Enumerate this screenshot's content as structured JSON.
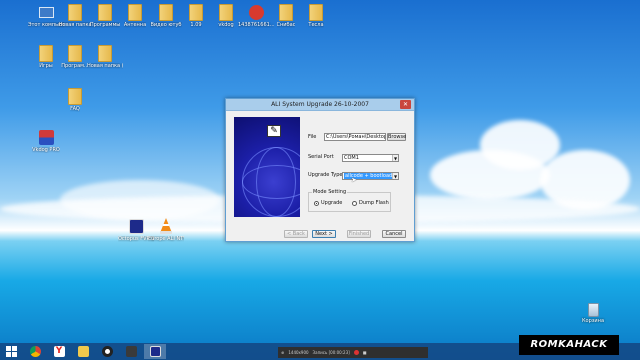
{
  "desktop": {
    "icons": [
      {
        "label": "Этот компьютер",
        "icon": "computer-icon"
      },
      {
        "label": "Новая папка",
        "icon": "folder-icon"
      },
      {
        "label": "Программы",
        "icon": "folder-icon"
      },
      {
        "label": "Антенна",
        "icon": "folder-icon"
      },
      {
        "label": "Видео ютуб",
        "icon": "folder-icon"
      },
      {
        "label": "1.09",
        "icon": "folder-icon"
      },
      {
        "label": "vkdog",
        "icon": "folder-icon"
      },
      {
        "label": "1438761661...",
        "icon": "app-icon"
      },
      {
        "label": "Снибас",
        "icon": "folder-icon"
      },
      {
        "label": "Тесла",
        "icon": "folder-icon"
      },
      {
        "label": "Игры",
        "icon": "folder-icon"
      },
      {
        "label": "Програм...",
        "icon": "folder-icon"
      },
      {
        "label": "Новая папка (2)",
        "icon": "folder-icon"
      },
      {
        "label": "FAQ",
        "icon": "folder-icon"
      },
      {
        "label": "Vkdog PRO",
        "icon": "app-icon"
      },
      {
        "label": "Octopus FVP SOFTWARE",
        "icon": "app-icon"
      },
      {
        "label": "Europe ALI NTV",
        "icon": "vlc-icon"
      },
      {
        "label": "Корзина",
        "icon": "recycle-bin-icon"
      }
    ]
  },
  "dialog": {
    "title": "ALI System Upgrade 26-10-2007",
    "close_glyph": "✕",
    "file_label": "File",
    "file_value": "C:\\Users\\Роман\\Desktop\\Eu",
    "browse_label": "Browse",
    "serial_label": "Serial Port",
    "serial_value": "COM1",
    "upgrade_label": "Upgrade Type",
    "upgrade_value": "allcode + bootloader",
    "mode_legend": "Mode Setting",
    "mode_upgrade": "Upgrade",
    "mode_dump": "Dump Flash",
    "back_label": "< Back",
    "next_label": "Next >",
    "finished_label": "Finished",
    "cancel_label": "Cancel"
  },
  "video_bar": {
    "resolution": "1440x900",
    "status": "Запись [00:00:23]"
  },
  "watermark": "ROMKAHACK",
  "colors": {
    "sky_top": "#1a6fd0",
    "water": "#18a9e6",
    "taskbar": "#144682",
    "dialog_title": "#a9cdeb",
    "selection": "#3399ff"
  }
}
